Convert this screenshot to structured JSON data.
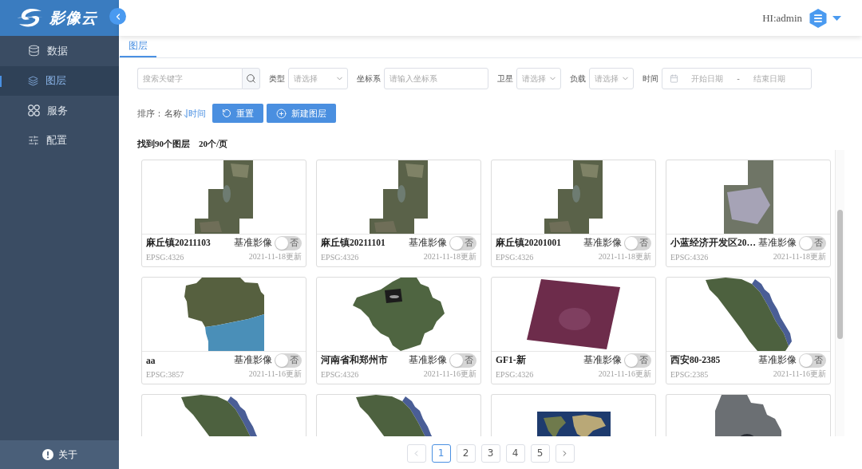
{
  "sidebar": {
    "logo": "影像云",
    "items": [
      {
        "kind": "database",
        "label": "数据",
        "selected": false
      },
      {
        "kind": "layers",
        "label": "图层",
        "selected": true
      },
      {
        "kind": "services",
        "label": "服务",
        "selected": false
      },
      {
        "kind": "settings",
        "label": "配置",
        "selected": false
      }
    ],
    "footer": "关于"
  },
  "header": {
    "user": "HI:admin"
  },
  "tabs": [
    {
      "label": "图层",
      "selected": true
    }
  ],
  "search": {
    "placeholder": "搜索关键字"
  },
  "filters": [
    {
      "kind": "select",
      "label": "类型",
      "placeholder": "请选择"
    },
    {
      "kind": "input",
      "label": "坐标系",
      "placeholder": "请输入坐标系"
    },
    {
      "kind": "select",
      "label": "卫星",
      "placeholder": "请选择"
    },
    {
      "kind": "select",
      "label": "负载",
      "placeholder": "请选择"
    },
    {
      "kind": "daterange",
      "label": "时间",
      "start_placeholder": "开始日期",
      "separator": "-",
      "end_placeholder": "结束日期"
    }
  ],
  "sort": {
    "label": "排序：",
    "options": [
      {
        "label": "名称",
        "selected": false
      },
      {
        "label": "时间",
        "selected": true
      }
    ]
  },
  "buttons": [
    {
      "kind": "reset",
      "label": "重置"
    },
    {
      "kind": "add",
      "label": "新建图层"
    }
  ],
  "summary": {
    "found": "找到90个图层",
    "per_page": "20个/页"
  },
  "layers": [
    {
      "kind": "steps",
      "name": "麻丘镇20211103",
      "toggle": {
        "label": "基准影像",
        "on": false,
        "text": "否"
      },
      "epsg": "EPSG:4326",
      "updated": "2021-11-18更新"
    },
    {
      "kind": "steps",
      "name": "麻丘镇20211101",
      "toggle": {
        "label": "基准影像",
        "on": false,
        "text": "否"
      },
      "epsg": "EPSG:4326",
      "updated": "2021-11-18更新"
    },
    {
      "kind": "steps",
      "name": "麻丘镇20201001",
      "toggle": {
        "label": "基准影像",
        "on": false,
        "text": "否"
      },
      "epsg": "EPSG:4326",
      "updated": "2021-11-18更新"
    },
    {
      "kind": "city",
      "name": "小蓝经济开发区20…",
      "toggle": {
        "label": "基准影像",
        "on": false,
        "text": "否"
      },
      "epsg": "EPSG:4326",
      "updated": "2021-11-18更新"
    },
    {
      "kind": "coast",
      "name": "aa",
      "toggle": {
        "label": "基准影像",
        "on": false,
        "text": "否"
      },
      "epsg": "EPSG:3857",
      "updated": "2021-11-16更新"
    },
    {
      "kind": "province",
      "name": "河南省和郑州市",
      "toggle": {
        "label": "基准影像",
        "on": false,
        "text": "否"
      },
      "epsg": "EPSG:4326",
      "updated": "2021-11-16更新"
    },
    {
      "kind": "tilted",
      "name": "GF1-新",
      "toggle": {
        "label": "基准影像",
        "on": false,
        "text": "否"
      },
      "epsg": "EPSG:4326",
      "updated": "2021-11-16更新"
    },
    {
      "kind": "diagonal",
      "name": "西安80-2385",
      "toggle": {
        "label": "基准影像",
        "on": false,
        "text": "否"
      },
      "epsg": "EPSG:2385",
      "updated": "2021-11-16更新"
    },
    {
      "kind": "diagonal"
    },
    {
      "kind": "diagonal"
    },
    {
      "kind": "world"
    },
    {
      "kind": "dense"
    }
  ],
  "pagination": {
    "previous": {
      "disabled": true
    },
    "pages": [
      {
        "label": "1",
        "selected": true
      },
      {
        "label": "2",
        "selected": false
      },
      {
        "label": "3",
        "selected": false
      },
      {
        "label": "4",
        "selected": false
      },
      {
        "label": "5",
        "selected": false
      }
    ],
    "next": {
      "disabled": false
    }
  }
}
